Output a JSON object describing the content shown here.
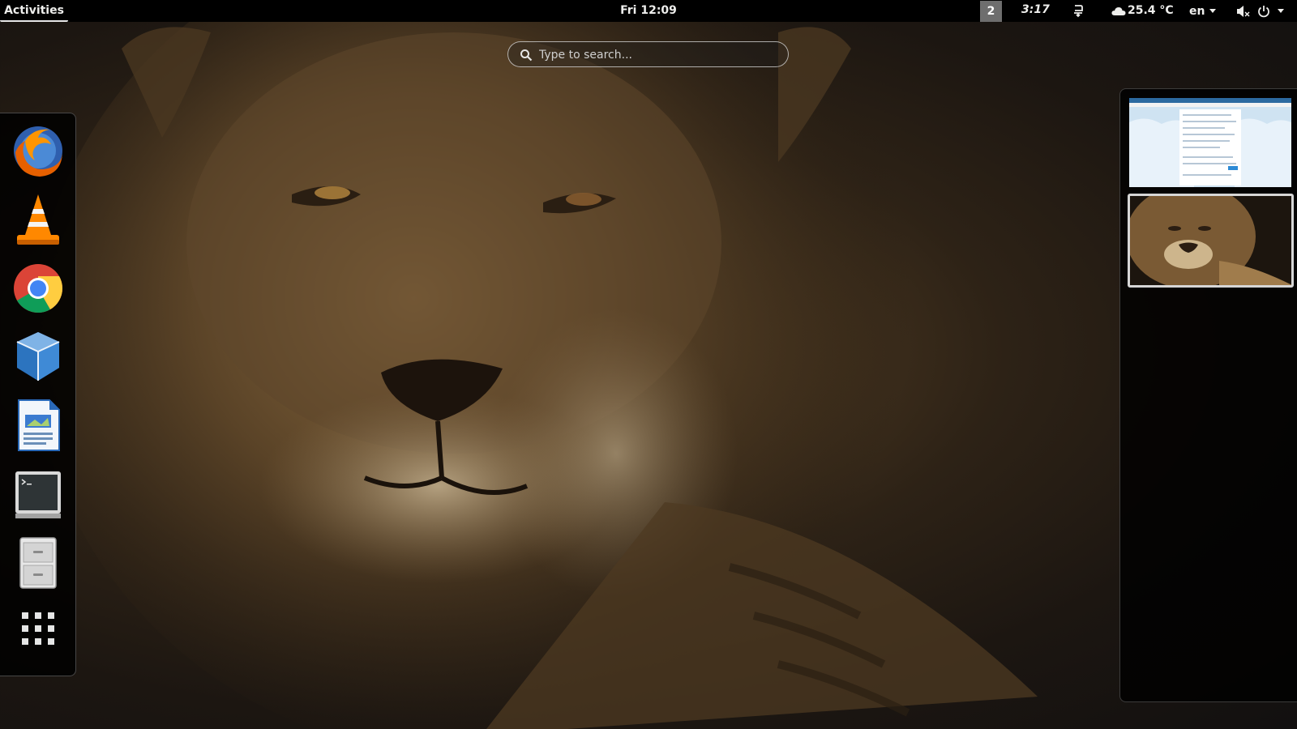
{
  "topbar": {
    "activities_label": "Activities",
    "clock": "Fri 12:09",
    "workspace_indicator": "2",
    "timer": "3:17",
    "weather": {
      "icon": "cloud-icon",
      "temperature": "25.4 °C"
    },
    "keyboard_layout": "en",
    "icons": [
      "tray-icon",
      "volume-muted-icon",
      "power-icon"
    ]
  },
  "search": {
    "placeholder": "Type to search..."
  },
  "dash": {
    "apps": [
      {
        "name": "Firefox",
        "icon": "firefox-icon"
      },
      {
        "name": "VLC media player",
        "icon": "vlc-icon"
      },
      {
        "name": "Google Chrome",
        "icon": "chrome-icon"
      },
      {
        "name": "VirtualBox",
        "icon": "virtualbox-icon"
      },
      {
        "name": "LibreOffice Writer",
        "icon": "writer-icon"
      },
      {
        "name": "Terminal",
        "icon": "terminal-icon"
      },
      {
        "name": "Files",
        "icon": "file-cabinet-icon"
      }
    ],
    "show_apps_icon": "grid-icon"
  },
  "workspaces": {
    "count": 2,
    "active_index": 1
  },
  "colors": {
    "topbar_bg": "#000000",
    "topbar_text": "#eeeeec",
    "panel_bg": "rgba(0,0,0,0.86)",
    "active_border": "#d6d6d6"
  }
}
